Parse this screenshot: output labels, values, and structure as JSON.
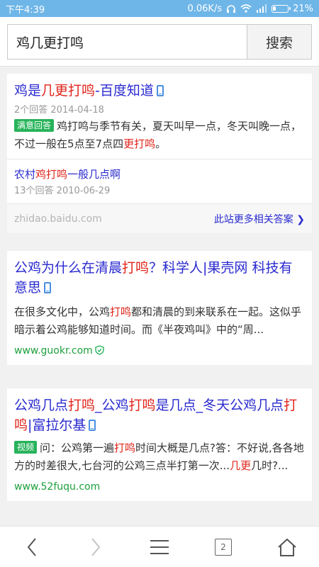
{
  "status": {
    "time": "下午4:39",
    "speed": "0.06K/s",
    "battery": "21%",
    "battery_level": 0.21
  },
  "search": {
    "query": "鸡几更打鸣",
    "button": "搜索"
  },
  "result1": {
    "title_parts": [
      "鸡是",
      "几更打鸣",
      "-百度知道"
    ],
    "meta": "2个回答  2014-04-18",
    "badge": "满意回答",
    "snippet_parts": [
      "鸡打鸣与季节有关，夏天叫早一点，冬天叫晚一点，不过一般在5点至7点四",
      "更打鸣",
      "。"
    ],
    "sub": {
      "title_parts": [
        "农村",
        "鸡打鸣",
        "一般几点啊"
      ],
      "meta": "13个回答  2010-06-29"
    },
    "site": "zhidao.baidu.com",
    "more": "此站更多相关答案 ❯"
  },
  "result2": {
    "title_parts": [
      "公鸡为什么在清晨",
      "打鸣",
      "？科学人|果壳网 科技有意思"
    ],
    "snippet_parts": [
      "在很多文化中，公鸡",
      "打鸣",
      "都和清晨的到来联系在一起。这似乎暗示着公鸡能够知道时间。而《半夜鸡叫》中的“周..."
    ],
    "url": "www.guokr.com"
  },
  "result3": {
    "title_parts": [
      "公鸡几点",
      "打鸣",
      "_公鸡",
      "打鸣",
      "是几点_冬天公鸡几点",
      "打鸣",
      "|富拉尔基"
    ],
    "badge": "视频",
    "snippet_parts": [
      "问：公鸡第一遍",
      "打鸣",
      "时间大概是几点?答：不好说,各各地方的时差很大,七台河的公鸡三点半打第一次...",
      "几更",
      "几时?..."
    ],
    "url": "www.52fuqu.com"
  },
  "nav": {
    "tabs": "2"
  },
  "colors": {
    "statusbar": "#6fb6e8",
    "link": "#2a2ad0",
    "highlight": "#e0251b",
    "url": "#1e9f3c",
    "badge": "#27b35a"
  }
}
